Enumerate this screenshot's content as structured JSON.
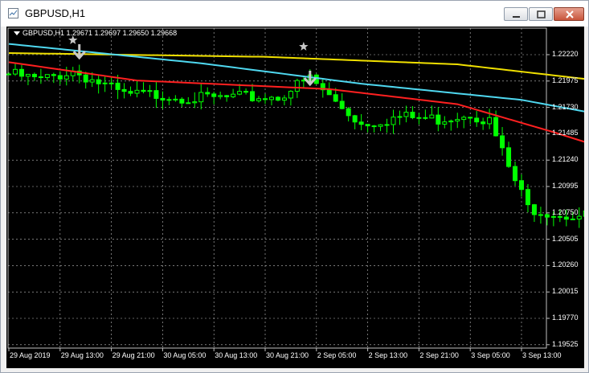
{
  "window": {
    "title": "GBPUSD,H1"
  },
  "chart": {
    "legend": "GBPUSD,H1  1.29671 1.29697 1.29650 1.29668",
    "price_axis": [
      "1.22220",
      "1.21975",
      "1.21730",
      "1.21485",
      "1.21240",
      "1.20995",
      "1.20750",
      "1.20505",
      "1.20260",
      "1.20015",
      "1.19770",
      "1.19525"
    ],
    "time_axis": [
      "29 Aug 2019",
      "29 Aug 13:00",
      "29 Aug 21:00",
      "30 Aug 05:00",
      "30 Aug 13:00",
      "30 Aug 21:00",
      "2 Sep 05:00",
      "2 Sep 13:00",
      "2 Sep 21:00",
      "3 Sep 05:00",
      "3 Sep 13:00"
    ],
    "colors": {
      "background": "#000000",
      "grid": "#c0c0c0",
      "candle": "#00ff00",
      "ma_fast": "#ff2020",
      "ma_mid": "#4fd8f0",
      "ma_slow": "#f0e000",
      "fractal": "#c8c8c8"
    },
    "markers": [
      {
        "type": "fractal-star",
        "color": "#c8c8c8"
      },
      {
        "type": "down-arrow",
        "color": "#c8c8c8"
      },
      {
        "type": "fractal-star",
        "color": "#c8c8c8"
      },
      {
        "type": "down-arrow",
        "color": "#c8c8c8"
      }
    ]
  }
}
